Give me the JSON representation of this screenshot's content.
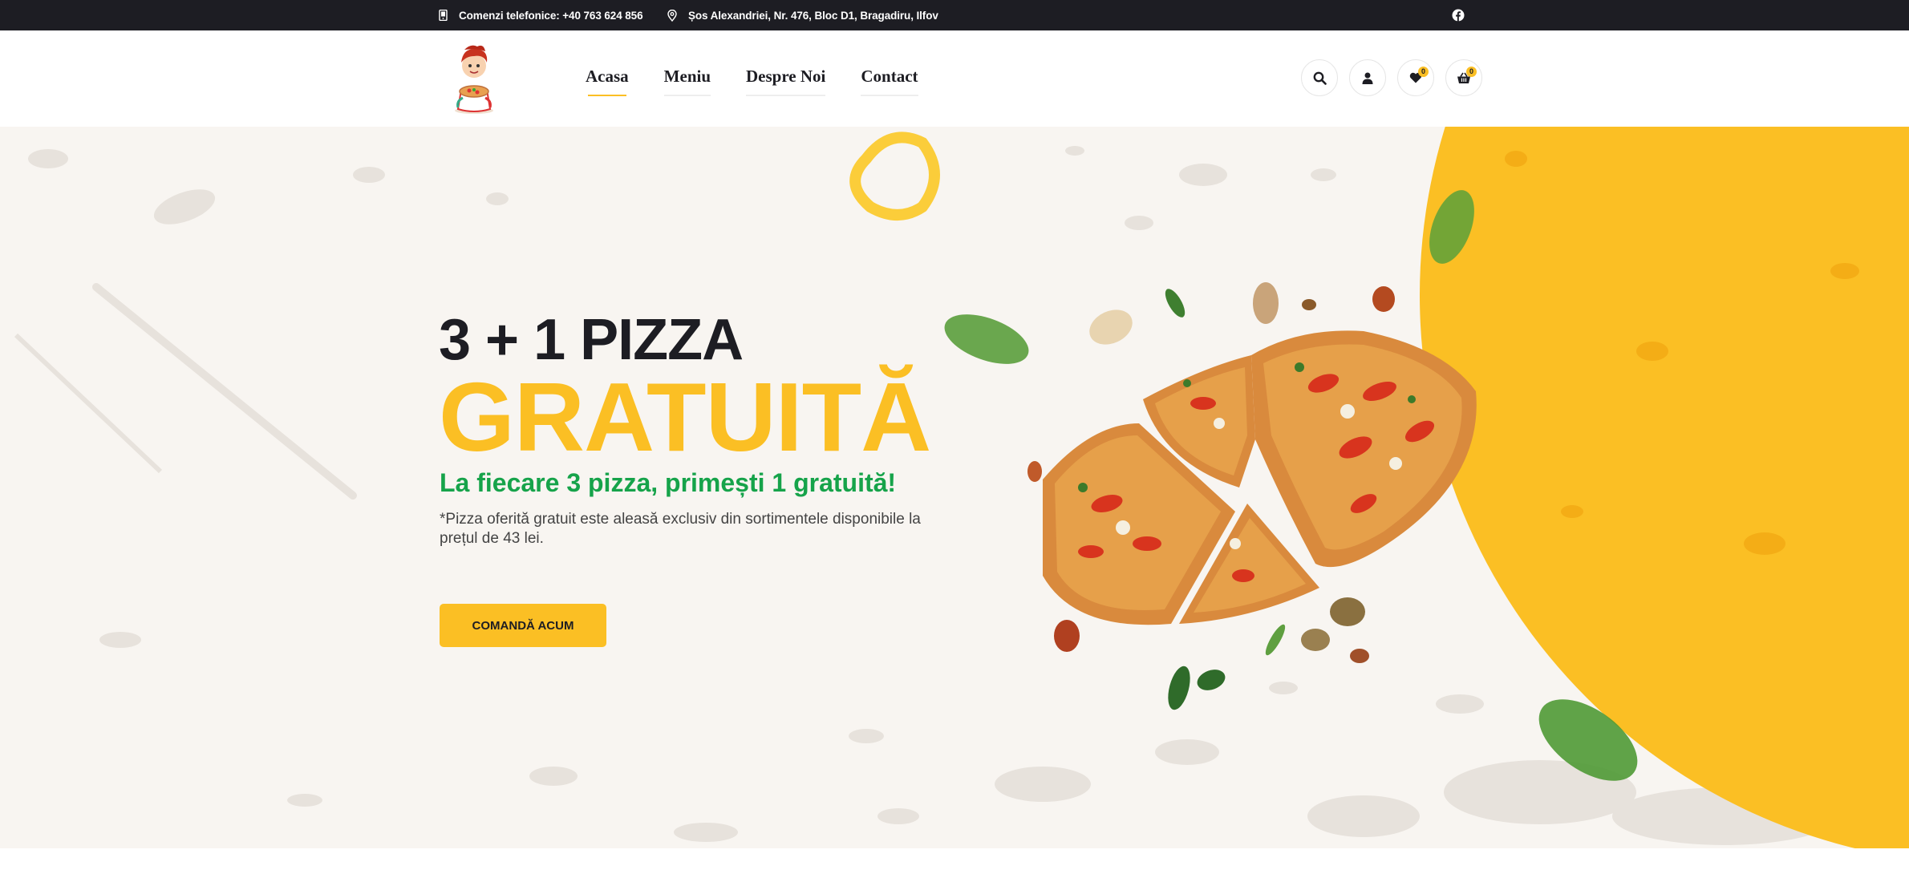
{
  "topbar": {
    "phone": "Comenzi telefonice: +40 763 624 856",
    "address": "Șos Alexandriei, Nr. 476, Bloc D1, Bragadiru, Ilfov",
    "phone_icon": "phone-icon",
    "address_icon": "map-pin-icon",
    "social_icon": "facebook-icon"
  },
  "header": {
    "logo_icon": "chef-mascot-logo",
    "nav": [
      {
        "label": "Acasa",
        "active": true
      },
      {
        "label": "Meniu",
        "active": false
      },
      {
        "label": "Despre Noi",
        "active": false
      },
      {
        "label": "Contact",
        "active": false
      }
    ],
    "icons": {
      "search": "search-icon",
      "account": "user-icon",
      "wishlist_count": "0",
      "cart_count": "0"
    }
  },
  "hero": {
    "title_line1": "3 + 1 PIZZA",
    "title_line2": "GRATUITĂ",
    "subtitle": "La fiecare 3 pizza, primești 1 gratuită!",
    "note": "*Pizza oferită gratuit este aleasă exclusiv din sortimentele disponibile la prețul de 43 lei.",
    "cta_label": "COMANDĂ ACUM"
  },
  "colors": {
    "dark": "#1d1d23",
    "accent": "#fbbf24",
    "green": "#16a34a",
    "hero_bg": "#f8f5f1"
  }
}
